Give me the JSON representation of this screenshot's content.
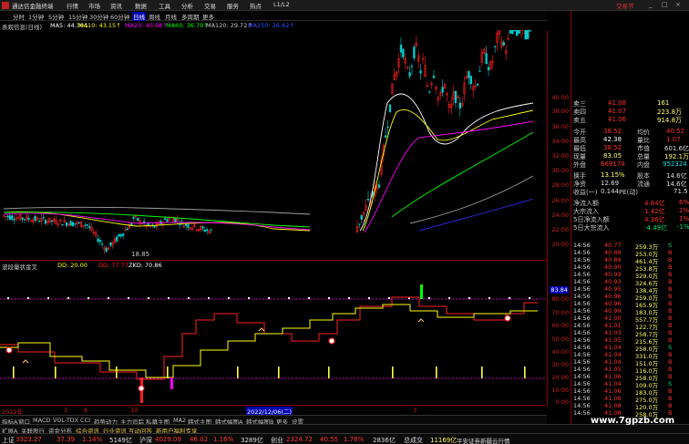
{
  "app": {
    "title": "通达信金融终端",
    "menus": [
      "行情",
      "市场",
      "资讯",
      "数据",
      "工具",
      "分析",
      "交易",
      "服务",
      "热点",
      "L1/L2"
    ],
    "trade_button": "交易节",
    "win_controls": [
      "_",
      "□",
      "×"
    ]
  },
  "periods": {
    "items": [
      "分时",
      "1分钟",
      "5分钟",
      "15分钟",
      "30分钟",
      "60分钟",
      "日线",
      "周线",
      "月线",
      "多周期",
      "更多"
    ],
    "active": "日线"
  },
  "main_indicator": {
    "name": "表观信息(日线)",
    "ma5": "MA5: 44.30↓",
    "ma10": "MA10: 43.15↑",
    "ma20": "MA20: 40.98↑",
    "ma60": "MA60: 36.79↑",
    "ma120": "MA120: 29.72↑",
    "ma250": "MA250: 26.62↑",
    "low_label": "18.85",
    "colors": {
      "ma5": "#ffffff",
      "ma10": "#ffff00",
      "ma20": "#ff00ff",
      "ma60": "#00ff00",
      "ma120": "#a0a0a0",
      "ma250": "#3030ff",
      "up": "#ff2020",
      "down": "#00d0d0"
    }
  },
  "price_axis": [
    "40.00",
    "38.00",
    "36.00",
    "34.00",
    "32.00",
    "30.00",
    "28.00",
    "26.00",
    "24.00",
    "22.00",
    "20.00"
  ],
  "sub_indicator": {
    "name": "波段量状金叉",
    "items": [
      "DD: 20.00",
      "DD: 77.77",
      "ZKD: 70.86"
    ],
    "axis": [
      "83.84",
      "80.00",
      "70.00",
      "60.00",
      "50.00",
      "40.00",
      "30.00",
      "20.00",
      "10.00",
      "0.00"
    ]
  },
  "dates": {
    "left": "2022年",
    "m2": "3",
    "m3": "6",
    "m4": "10",
    "highlight": "2022/12/06(二)",
    "m5": "3"
  },
  "bottom_tabs": [
    "指标A",
    "窗口",
    "MACD",
    "VOL-TDX",
    "CCI",
    "趋势动力",
    "主力追踪",
    "私募主图",
    "MA2",
    "韩式主图",
    "韩式幅图A",
    "韩式幅图B",
    "更多",
    "设置"
  ],
  "sub_tabs": [
    "扩展A",
    "关联股行",
    "资金分布",
    "综合资讯",
    "行业资讯",
    "互动问答",
    "新用户福利专享"
  ],
  "status": {
    "sh_name": "上证",
    "sh_value": "3323.27",
    "sh_chg": "37.39",
    "sh_pct": "1.14%",
    "sh_amt": "5149亿",
    "hs_name": "沪深",
    "hs_value": "4029.09",
    "hs_chg": "46.02",
    "hs_pct": "1.16%",
    "hs_amt": "3289亿",
    "cy_name": "创业",
    "cy_value": "2324.72",
    "cy_chg": "40.55",
    "cy_pct": "1.78%",
    "cy_amt": "2836亿",
    "zs_name": "总成交",
    "zs_value": "11169亿",
    "broker": "平安证券新疆云行情"
  },
  "quote": {
    "asks": [
      {
        "label": "卖三",
        "price": "41.08",
        "vol": "161"
      },
      {
        "label": "卖四",
        "price": "41.07",
        "vol": "223.8万"
      },
      {
        "label": "卖五",
        "price": "41.06",
        "vol": "914.8万"
      }
    ],
    "stats": [
      {
        "l1": "今开",
        "v1": "38.52",
        "l2": "均价",
        "v2": "40.52"
      },
      {
        "l1": "最高",
        "v1": "42.38",
        "l2": "量比",
        "v2": "1.07"
      },
      {
        "l1": "最低",
        "v1": "38.52",
        "l2": "市值",
        "v2": "601.6亿"
      },
      {
        "l1": "现量",
        "v1": "83.05",
        "l2": "总量",
        "v2": "192.1万"
      },
      {
        "l1": "外盘",
        "v1": "669174",
        "l2": "内盘",
        "v2": "952324"
      }
    ],
    "stats2": [
      {
        "l1": "换手",
        "v1": "13.15%",
        "l2": "股本",
        "v2": "14.6亿"
      },
      {
        "l1": "净资",
        "v1": "12.69",
        "l2": "流通",
        "v2": "14.6亿"
      },
      {
        "l1": "收益(一)",
        "v1": "0.144",
        "l2": "PE(动)",
        "v2": "71.5"
      }
    ],
    "flows": [
      {
        "label": "净流入额",
        "val": "4.84亿",
        "pct": "6%"
      },
      {
        "label": "大宗流入",
        "val": "1.42亿",
        "pct": "2%"
      },
      {
        "label": "5日净流入额",
        "val": "4.36亿",
        "pct": "1%"
      },
      {
        "label": "5日大宗流入",
        "val": "-4.49亿",
        "pct": "-1%"
      }
    ]
  },
  "trades": [
    {
      "t": "14:56",
      "p": "40.77",
      "v": "259.3万",
      "d": "S"
    },
    {
      "t": "14:56",
      "p": "40.89",
      "v": "253.0万",
      "d": "B"
    },
    {
      "t": "14:56",
      "p": "40.89",
      "v": "461.4万",
      "d": "B"
    },
    {
      "t": "14:56",
      "p": "40.90",
      "v": "253.8万",
      "d": "B"
    },
    {
      "t": "14:56",
      "p": "40.93",
      "v": "329.0万",
      "d": "B"
    },
    {
      "t": "14:56",
      "p": "40.93",
      "v": "324.6万",
      "d": "B"
    },
    {
      "t": "14:56",
      "p": "40.95",
      "v": "138.4万",
      "d": "B"
    },
    {
      "t": "14:56",
      "p": "40.96",
      "v": "259.0万",
      "d": "B"
    },
    {
      "t": "14:56",
      "p": "40.96",
      "v": "165.9万",
      "d": "B"
    },
    {
      "t": "14:56",
      "p": "40.99",
      "v": "183.0万",
      "d": "B"
    },
    {
      "t": "14:56",
      "p": "41.00",
      "v": "557.7万",
      "d": "B"
    },
    {
      "t": "14:56",
      "p": "41.01",
      "v": "122.7万",
      "d": "B"
    },
    {
      "t": "14:56",
      "p": "41.03",
      "v": "258.7万",
      "d": "B"
    },
    {
      "t": "14:56",
      "p": "41.05",
      "v": "215.6万",
      "d": "B"
    },
    {
      "t": "14:56",
      "p": "41.04",
      "v": "258.0万",
      "d": "S"
    },
    {
      "t": "14:56",
      "p": "41.04",
      "v": "331.0万",
      "d": "B"
    },
    {
      "t": "14:56",
      "p": "41.04",
      "v": "151.0万",
      "d": "B"
    },
    {
      "t": "14:56",
      "p": "41.05",
      "v": "116.0万",
      "d": "B"
    },
    {
      "t": "14:56",
      "p": "41.06",
      "v": "258.0万",
      "d": "B"
    },
    {
      "t": "14:56",
      "p": "41.04",
      "v": "109.0万",
      "d": "S"
    },
    {
      "t": "14:56",
      "p": "41.06",
      "v": "183.0万",
      "d": "B"
    },
    {
      "t": "14:56",
      "p": "41.06",
      "v": "275.0万",
      "d": "B"
    },
    {
      "t": "14:56",
      "p": "41.08",
      "v": "120.0万",
      "d": "B"
    },
    {
      "t": "14:56",
      "p": "41.08",
      "v": "258.0万",
      "d": "B"
    }
  ],
  "watermark": "www.7gpzb.com"
}
